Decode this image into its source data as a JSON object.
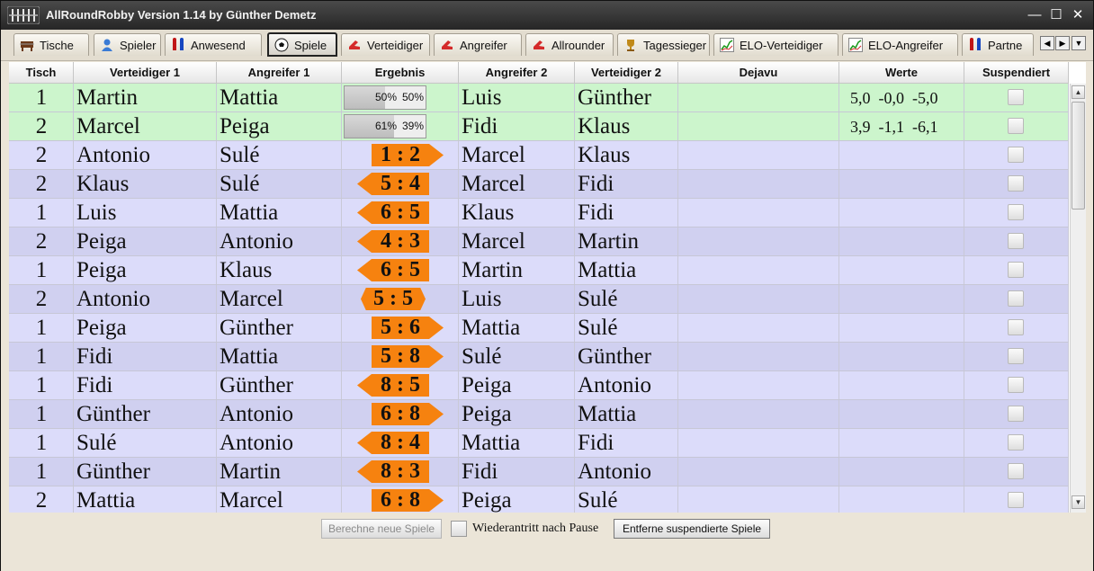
{
  "window": {
    "title": "AllRoundRobby Version 1.14 by Günther Demetz"
  },
  "window_controls": {
    "minimize": "—",
    "maximize": "☐",
    "close": "✕"
  },
  "tabs": [
    {
      "label": "Tische",
      "icon": "table-soccer-icon",
      "active": false
    },
    {
      "label": "Spieler",
      "icon": "user-icon",
      "active": false
    },
    {
      "label": "Anwesend",
      "icon": "players-icon",
      "active": false
    },
    {
      "label": "Spiele",
      "icon": "soccer-ball-icon",
      "active": true
    },
    {
      "label": "Verteidiger",
      "icon": "shoe-icon",
      "active": false
    },
    {
      "label": "Angreifer",
      "icon": "shoe-icon",
      "active": false
    },
    {
      "label": "Allrounder",
      "icon": "shoe-icon",
      "active": false
    },
    {
      "label": "Tagessieger",
      "icon": "trophy-icon",
      "active": false
    },
    {
      "label": "ELO-Verteidiger",
      "icon": "chart-icon",
      "active": false
    },
    {
      "label": "ELO-Angreifer",
      "icon": "chart-icon",
      "active": false
    },
    {
      "label": "Partne",
      "icon": "players-icon",
      "active": false
    }
  ],
  "tab_scroll": {
    "left": "◀",
    "right": "▶",
    "menu": "▼"
  },
  "table": {
    "headers": [
      "Tisch",
      "Verteidiger 1",
      "Angreifer 1",
      "Ergebnis",
      "Angreifer 2",
      "Verteidiger 2",
      "Dejavu",
      "Werte",
      "Suspendiert"
    ],
    "rows": [
      {
        "tisch": "1",
        "v1": "Martin",
        "a1": "Mattia",
        "type": "prob",
        "p1": 0.5,
        "p1_label": "50%",
        "p2_label": "50%",
        "a2": "Luis",
        "v2": "Günther",
        "werte": "5,0  -0,0  -5,0",
        "status": "pending"
      },
      {
        "tisch": "2",
        "v1": "Marcel",
        "a1": "Peiga",
        "type": "prob",
        "p1": 0.61,
        "p1_label": "61%",
        "p2_label": "39%",
        "a2": "Fidi",
        "v2": "Klaus",
        "werte": "3,9  -1,1  -6,1",
        "status": "pending"
      },
      {
        "tisch": "2",
        "v1": "Antonio",
        "a1": "Sulé",
        "type": "score",
        "score": "1 : 2",
        "arrow": "right",
        "a2": "Marcel",
        "v2": "Klaus",
        "werte": "",
        "status": "done"
      },
      {
        "tisch": "2",
        "v1": "Klaus",
        "a1": "Sulé",
        "type": "score",
        "score": "5 : 4",
        "arrow": "left",
        "a2": "Marcel",
        "v2": "Fidi",
        "werte": "",
        "status": "done"
      },
      {
        "tisch": "1",
        "v1": "Luis",
        "a1": "Mattia",
        "type": "score",
        "score": "6 : 5",
        "arrow": "left",
        "a2": "Klaus",
        "v2": "Fidi",
        "werte": "",
        "status": "done"
      },
      {
        "tisch": "2",
        "v1": "Peiga",
        "a1": "Antonio",
        "type": "score",
        "score": "4 : 3",
        "arrow": "left",
        "a2": "Marcel",
        "v2": "Martin",
        "werte": "",
        "status": "done"
      },
      {
        "tisch": "1",
        "v1": "Peiga",
        "a1": "Klaus",
        "type": "score",
        "score": "6 : 5",
        "arrow": "left",
        "a2": "Martin",
        "v2": "Mattia",
        "werte": "",
        "status": "done"
      },
      {
        "tisch": "2",
        "v1": "Antonio",
        "a1": "Marcel",
        "type": "score",
        "score": "5 : 5",
        "arrow": "both",
        "a2": "Luis",
        "v2": "Sulé",
        "werte": "",
        "status": "done"
      },
      {
        "tisch": "1",
        "v1": "Peiga",
        "a1": "Günther",
        "type": "score",
        "score": "5 : 6",
        "arrow": "right",
        "a2": "Mattia",
        "v2": "Sulé",
        "werte": "",
        "status": "done"
      },
      {
        "tisch": "1",
        "v1": "Fidi",
        "a1": "Mattia",
        "type": "score",
        "score": "5 : 8",
        "arrow": "right",
        "a2": "Sulé",
        "v2": "Günther",
        "werte": "",
        "status": "done"
      },
      {
        "tisch": "1",
        "v1": "Fidi",
        "a1": "Günther",
        "type": "score",
        "score": "8 : 5",
        "arrow": "left",
        "a2": "Peiga",
        "v2": "Antonio",
        "werte": "",
        "status": "done"
      },
      {
        "tisch": "1",
        "v1": "Günther",
        "a1": "Antonio",
        "type": "score",
        "score": "6 : 8",
        "arrow": "right",
        "a2": "Peiga",
        "v2": "Mattia",
        "werte": "",
        "status": "done"
      },
      {
        "tisch": "1",
        "v1": "Sulé",
        "a1": "Antonio",
        "type": "score",
        "score": "8 : 4",
        "arrow": "left",
        "a2": "Mattia",
        "v2": "Fidi",
        "werte": "",
        "status": "done"
      },
      {
        "tisch": "1",
        "v1": "Günther",
        "a1": "Martin",
        "type": "score",
        "score": "8 : 3",
        "arrow": "left",
        "a2": "Fidi",
        "v2": "Antonio",
        "werte": "",
        "status": "done"
      },
      {
        "tisch": "2",
        "v1": "Mattia",
        "a1": "Marcel",
        "type": "score",
        "score": "6 : 8",
        "arrow": "right",
        "a2": "Peiga",
        "v2": "Sulé",
        "werte": "",
        "status": "done"
      }
    ]
  },
  "colors": {
    "pending_row": "#ccf5cc",
    "done_row_a": "#dcdcfa",
    "done_row_b": "#d0d0f0",
    "score_arrow": "#f6820f"
  },
  "scrollbar": {
    "up": "▲",
    "down": "▼"
  },
  "bottom": {
    "compute_button": "Berechne neue Spiele",
    "rematch_label": "Wiederantritt nach Pause",
    "remove_button": "Entferne suspendierte Spiele"
  }
}
